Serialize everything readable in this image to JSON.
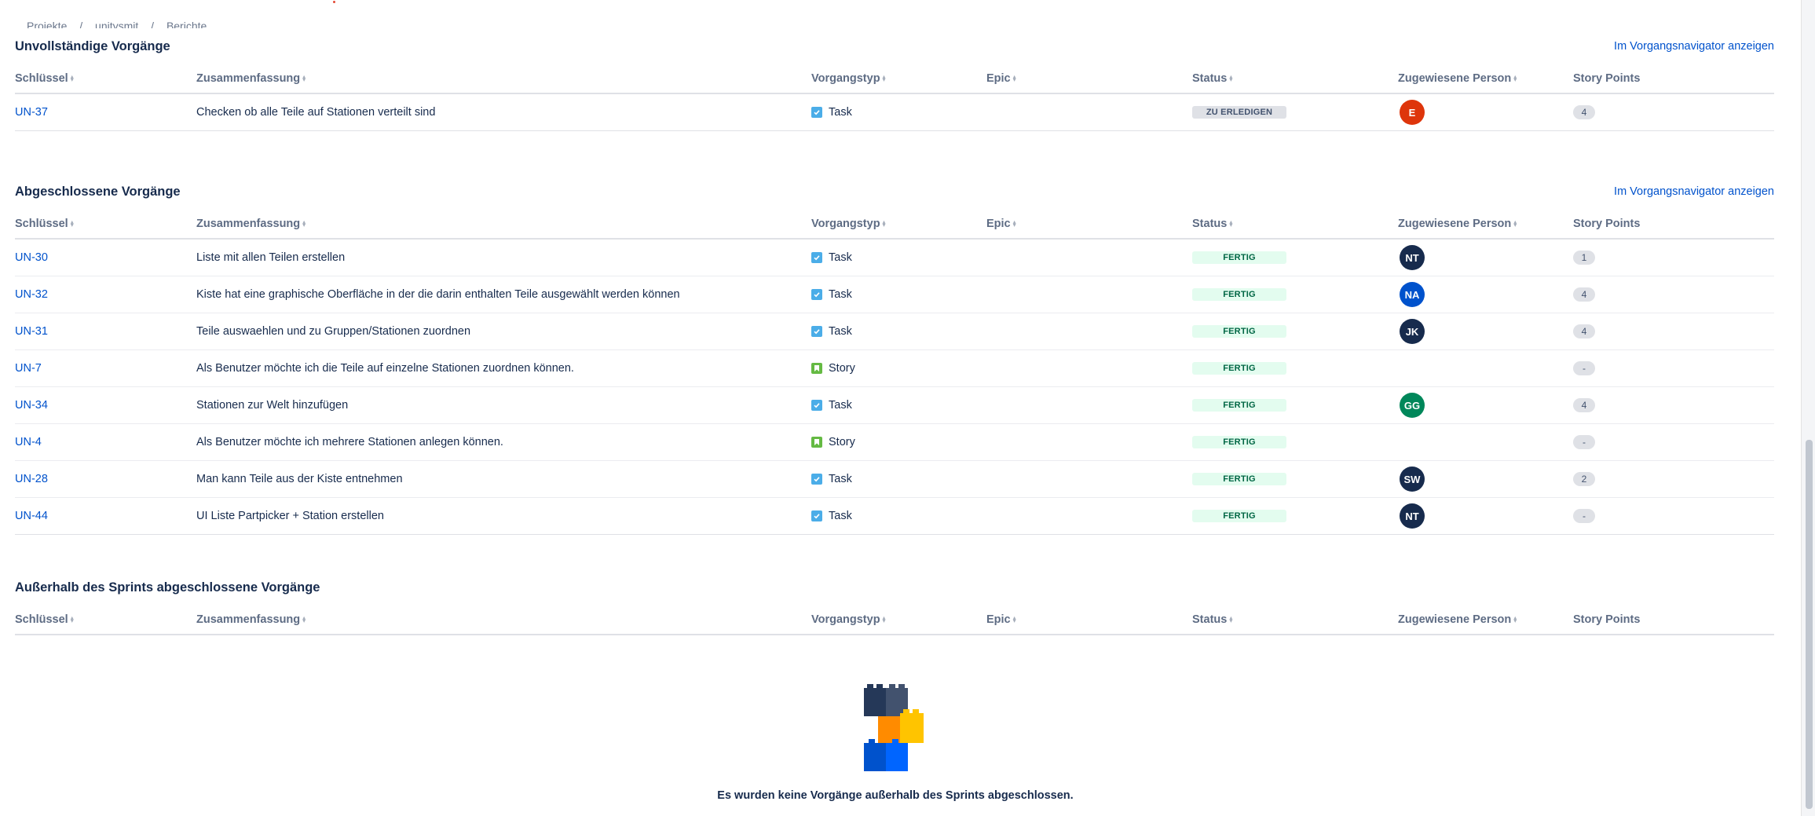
{
  "breadcrumb": [
    "Projekte",
    "/",
    "unitysmit",
    "/",
    "Berichte"
  ],
  "columns": [
    "Schlüssel",
    "Zusammenfassung",
    "Vorgangstyp",
    "Epic",
    "Status",
    "Zugewiesene Person",
    "Story Points"
  ],
  "sections": {
    "incomplete": {
      "title": "Unvollständige Vorgänge",
      "link": "Im Vorgangsnavigator anzeigen",
      "rows": [
        {
          "key": "UN-37",
          "summary": "Checken ob alle Teile auf Stationen verteilt sind",
          "type": "Task",
          "type_icon": "task-icon",
          "epic": "",
          "status": "ZU ERLEDIGEN",
          "assignee": "E",
          "assignee_color": "#de350b",
          "points": "4"
        }
      ]
    },
    "completed": {
      "title": "Abgeschlossene Vorgänge",
      "link": "Im Vorgangsnavigator anzeigen",
      "rows": [
        {
          "key": "UN-30",
          "summary": "Liste mit allen Teilen erstellen",
          "type": "Task",
          "type_icon": "task-icon",
          "epic": "",
          "status": "FERTIG",
          "assignee": "NT",
          "assignee_color": "#172b4d",
          "points": "1"
        },
        {
          "key": "UN-32",
          "summary": "Kiste hat eine graphische Oberfläche in der die darin enthalten Teile ausgewählt werden können",
          "type": "Task",
          "type_icon": "task-icon",
          "epic": "",
          "status": "FERTIG",
          "assignee": "NA",
          "assignee_color": "#0052cc",
          "points": "4"
        },
        {
          "key": "UN-31",
          "summary": "Teile auswaehlen und zu Gruppen/Stationen zuordnen",
          "type": "Task",
          "type_icon": "task-icon",
          "epic": "",
          "status": "FERTIG",
          "assignee": "JK",
          "assignee_color": "#172b4d",
          "points": "4"
        },
        {
          "key": "UN-7",
          "summary": "Als Benutzer möchte ich die Teile auf einzelne Stationen zuordnen können.",
          "type": "Story",
          "type_icon": "story-icon",
          "epic": "",
          "status": "FERTIG",
          "assignee": "",
          "assignee_color": "",
          "points": "-"
        },
        {
          "key": "UN-34",
          "summary": "Stationen zur Welt hinzufügen",
          "type": "Task",
          "type_icon": "task-icon",
          "epic": "",
          "status": "FERTIG",
          "assignee": "GG",
          "assignee_color": "#00875a",
          "points": "4"
        },
        {
          "key": "UN-4",
          "summary": "Als Benutzer möchte ich mehrere Stationen anlegen können.",
          "type": "Story",
          "type_icon": "story-icon",
          "epic": "",
          "status": "FERTIG",
          "assignee": "",
          "assignee_color": "",
          "points": "-"
        },
        {
          "key": "UN-28",
          "summary": "Man kann Teile aus der Kiste entnehmen",
          "type": "Task",
          "type_icon": "task-icon",
          "epic": "",
          "status": "FERTIG",
          "assignee": "SW",
          "assignee_color": "#172b4d",
          "points": "2"
        },
        {
          "key": "UN-44",
          "summary": "UI Liste Partpicker + Station erstellen",
          "type": "Task",
          "type_icon": "task-icon",
          "epic": "",
          "status": "FERTIG",
          "assignee": "NT",
          "assignee_color": "#172b4d",
          "points": "-"
        }
      ]
    },
    "outside": {
      "title": "Außerhalb des Sprints abgeschlossene Vorgänge",
      "rows": []
    }
  },
  "empty_state": {
    "icon": "lego-blocks-icon",
    "text": "Es wurden keine Vorgänge außerhalb des Sprints abgeschlossen."
  },
  "colors": {
    "link": "#0052cc",
    "todo_lozenge": "#dfe1e6",
    "done_lozenge": "#e3fcef",
    "done_text": "#006644"
  }
}
